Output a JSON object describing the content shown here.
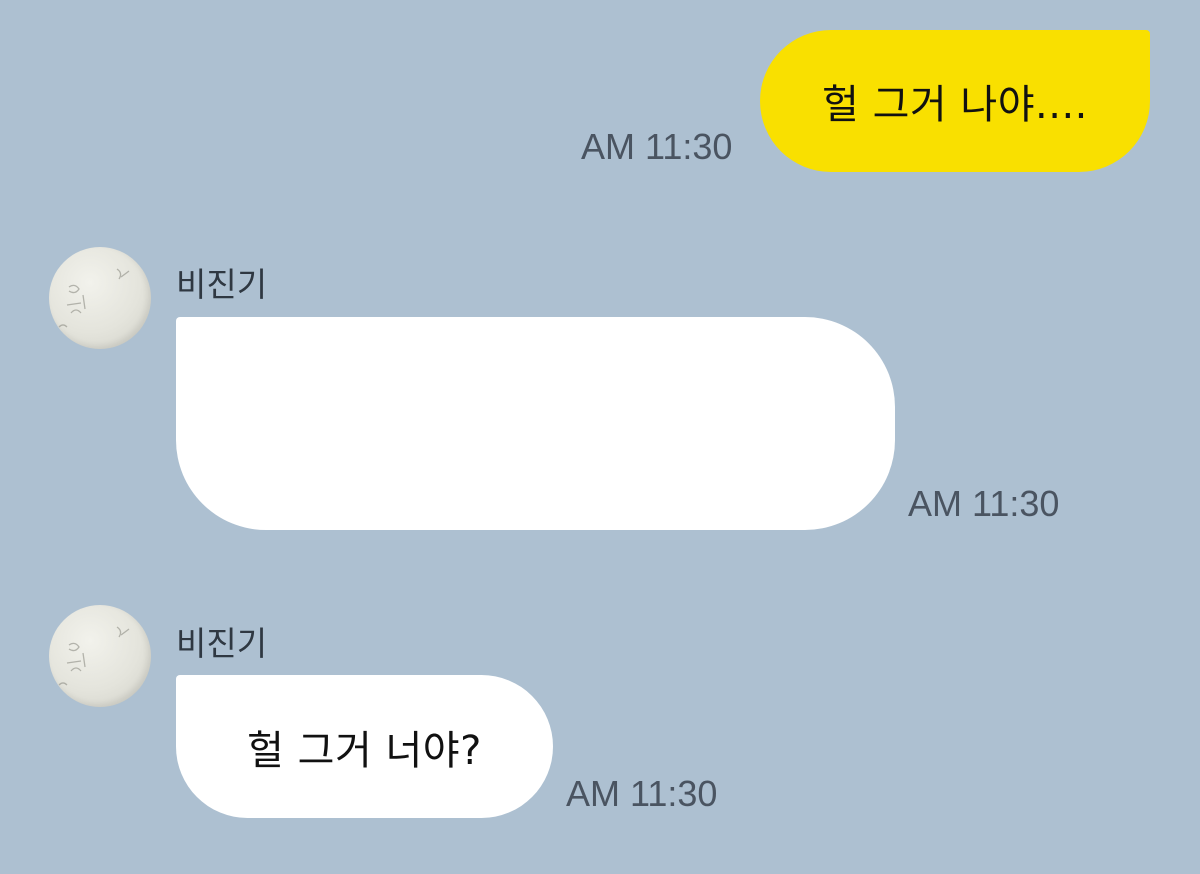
{
  "colors": {
    "background": "#adc0d1",
    "outgoing_bubble": "#f9e000",
    "incoming_bubble": "#ffffff",
    "timestamp": "#4a5461"
  },
  "messages": [
    {
      "direction": "outgoing",
      "text": "헐 그거 나야....",
      "time": "AM 11:30"
    },
    {
      "direction": "incoming",
      "sender": "비진기",
      "text": "",
      "time": "AM 11:30"
    },
    {
      "direction": "incoming",
      "sender": "비진기",
      "text": "헐 그거 너야?",
      "time": "AM 11:30"
    }
  ]
}
